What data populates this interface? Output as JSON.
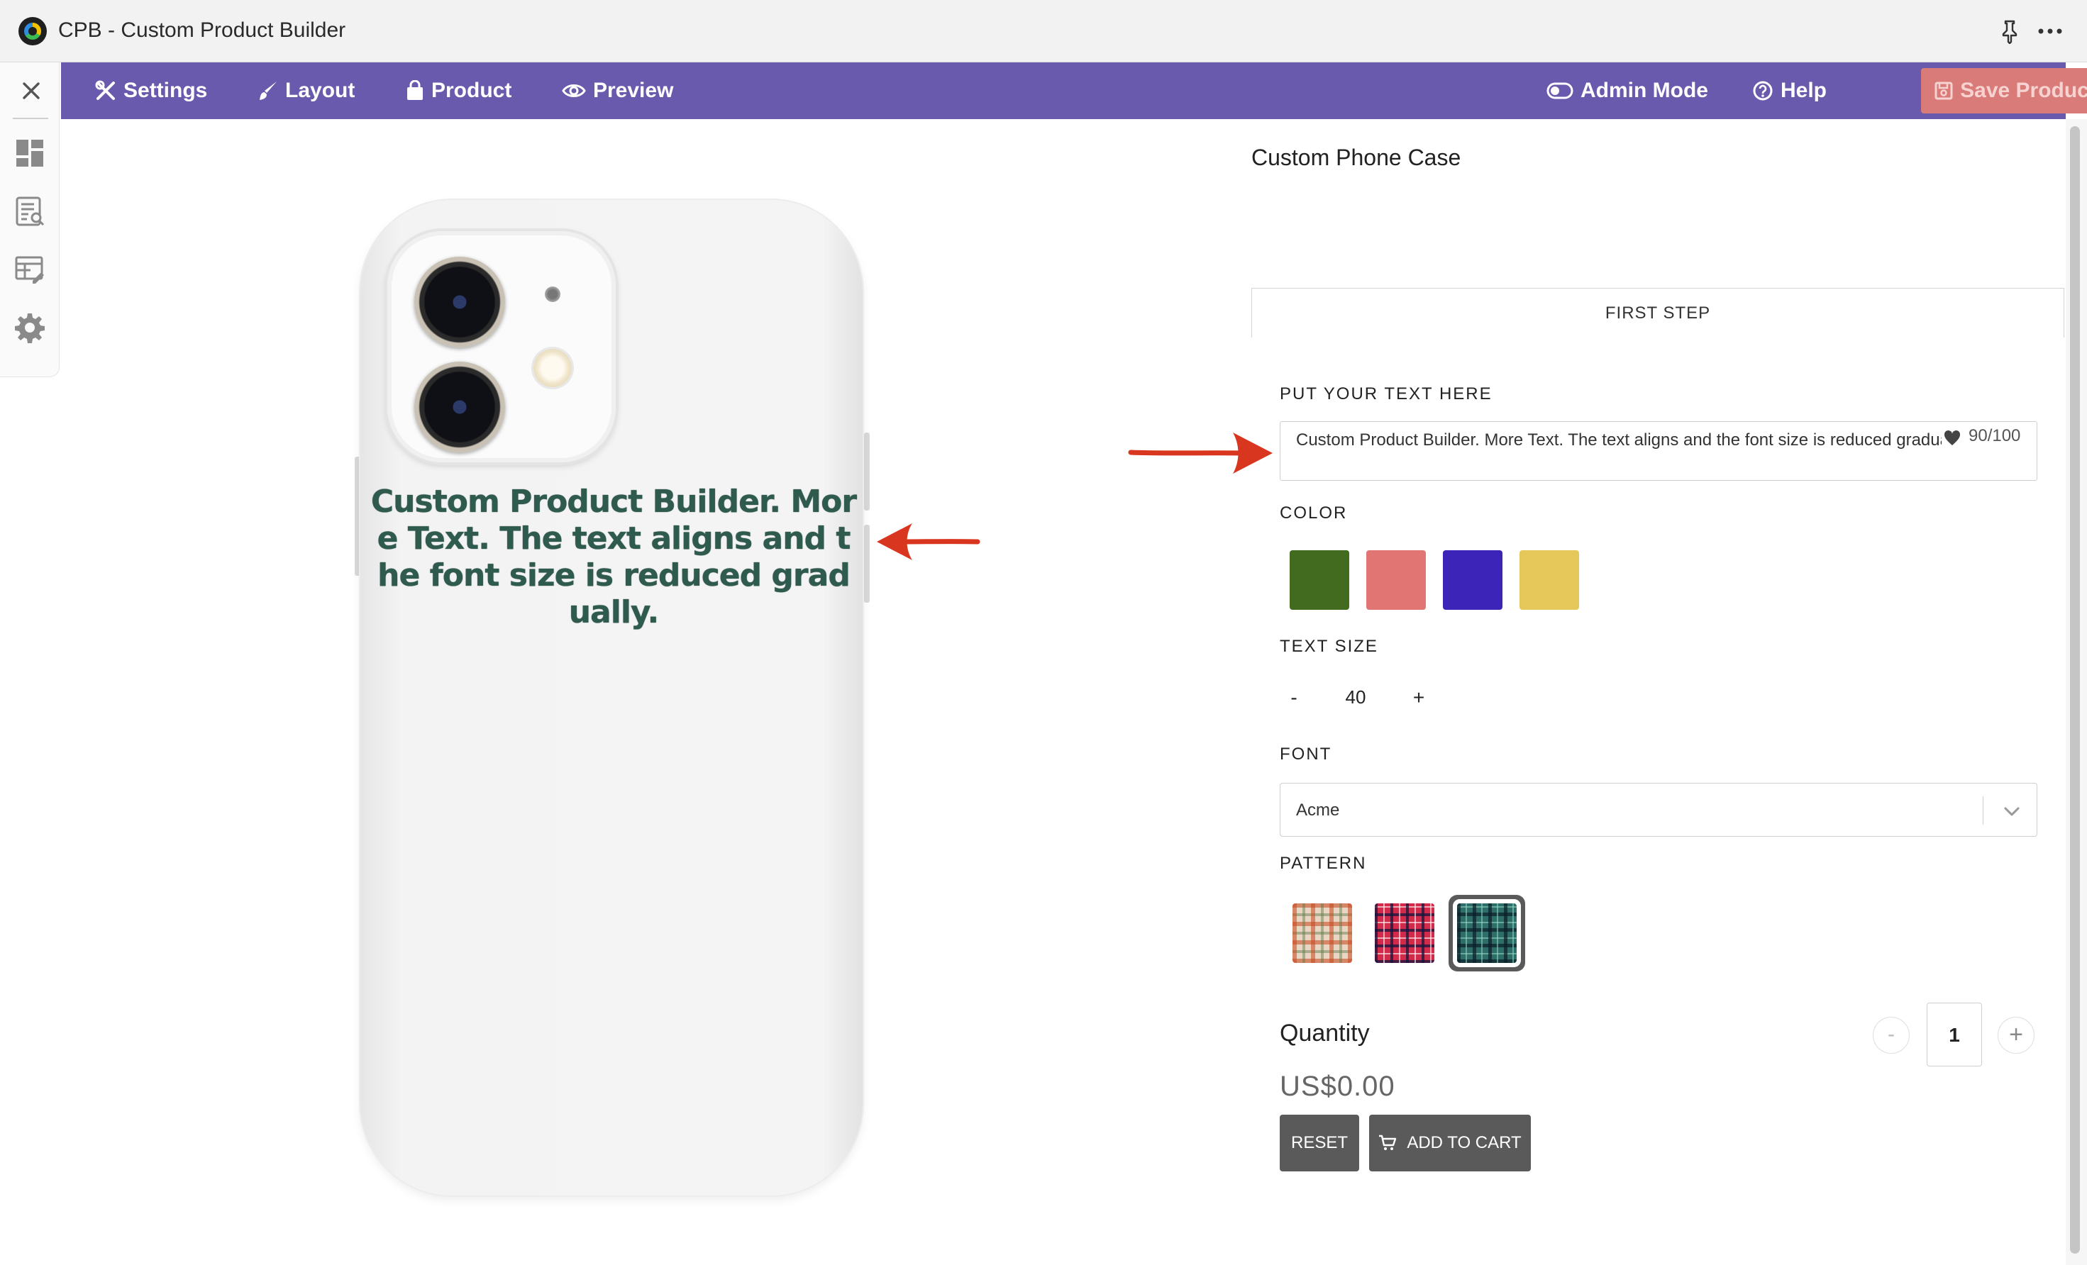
{
  "window": {
    "title": "CPB - Custom Product Builder"
  },
  "toolbar": {
    "settings": "Settings",
    "layout": "Layout",
    "product": "Product",
    "preview": "Preview",
    "admin_mode": "Admin Mode",
    "help": "Help",
    "save": "Save Product"
  },
  "preview": {
    "engraved_text": "Custom Product Builder. More Text. The text aligns and the font size is reduced gradually."
  },
  "product": {
    "title": "Custom Phone Case",
    "step_tab": "FIRST STEP",
    "text_field": {
      "label": "PUT YOUR TEXT HERE",
      "value": "Custom Product Builder. More Text. The text aligns and the font size is reduced gradually.",
      "counter": "90/100"
    },
    "color": {
      "label": "COLOR",
      "swatches": [
        "#436b1f",
        "#e07573",
        "#3c24b8",
        "#e6c85a"
      ]
    },
    "text_size": {
      "label": "TEXT SIZE",
      "minus": "-",
      "value": "40",
      "plus": "+"
    },
    "font": {
      "label": "FONT",
      "selected": "Acme"
    },
    "pattern": {
      "label": "PATTERN",
      "options": [
        "orange-plaid",
        "red-plaid",
        "teal-plaid"
      ],
      "selected": "teal-plaid"
    },
    "quantity": {
      "label": "Quantity",
      "minus": "-",
      "value": "1",
      "plus": "+"
    },
    "price": "US$0.00",
    "reset": "RESET",
    "add_to_cart": "ADD TO CART"
  },
  "colors": {
    "toolbar": "#6a5aad",
    "save_button": "#d97b78",
    "dark_button": "#5a5a5a",
    "annotation_arrow": "#d8361e"
  },
  "icons": {
    "rail": [
      "close-icon",
      "dashboard-icon",
      "list-search-icon",
      "table-edit-icon",
      "gear-icon"
    ],
    "title_bar": [
      "pin-icon",
      "more-icon"
    ]
  }
}
